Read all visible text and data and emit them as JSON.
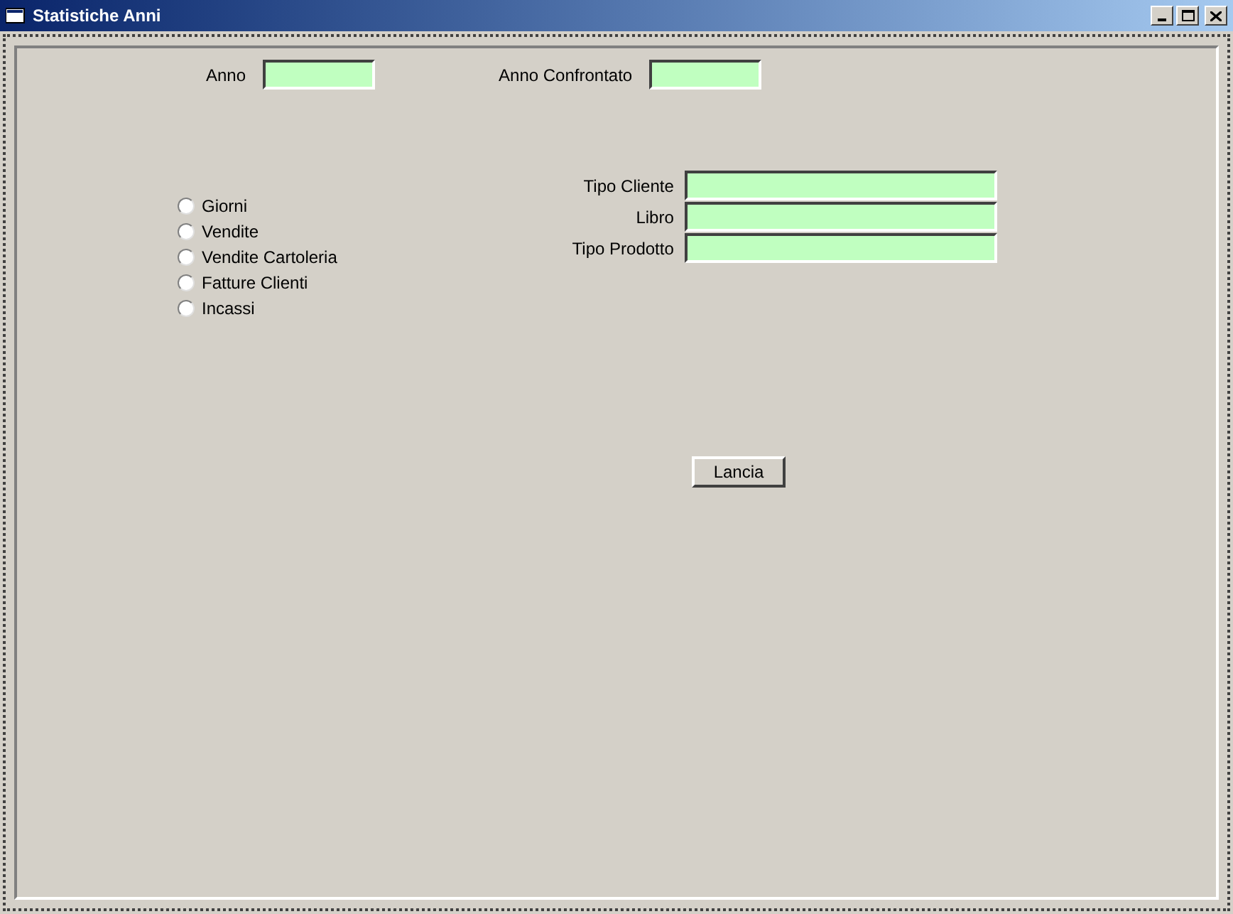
{
  "window": {
    "title": "Statistiche Anni"
  },
  "year_fields": [
    {
      "label": "Anno"
    },
    {
      "label": "Anno Confrontato"
    }
  ],
  "radio_options": [
    {
      "label": "Giorni",
      "selected": false
    },
    {
      "label": "Vendite",
      "selected": false
    },
    {
      "label": "Vendite Cartoleria",
      "selected": false
    },
    {
      "label": "Fatture Clienti",
      "selected": false
    },
    {
      "label": "Incassi",
      "selected": false
    }
  ],
  "filter_fields": [
    {
      "label": "Tipo Cliente"
    },
    {
      "label": "Libro"
    },
    {
      "label": "Tipo Prodotto"
    }
  ],
  "button": "Lancia"
}
